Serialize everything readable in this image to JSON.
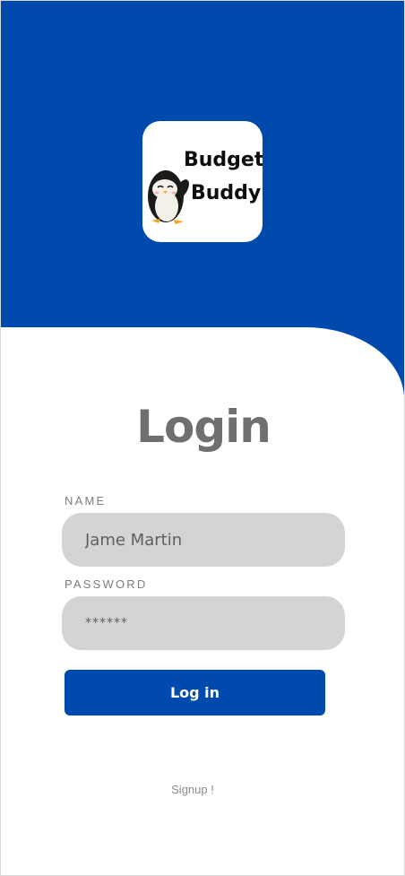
{
  "logo": {
    "line1": "Budget",
    "line2": "Buddy",
    "icon": "penguin-icon"
  },
  "title": "Login",
  "form": {
    "name_label": "NAME",
    "name_value": "Jame Martin",
    "password_label": "PASSWORD",
    "password_value": "******"
  },
  "login_button": "Log in",
  "signup_link": "Signup !",
  "colors": {
    "brand_blue": "#004aad",
    "input_bg": "#d4d4d4",
    "title_gray": "#6f6f6f"
  }
}
